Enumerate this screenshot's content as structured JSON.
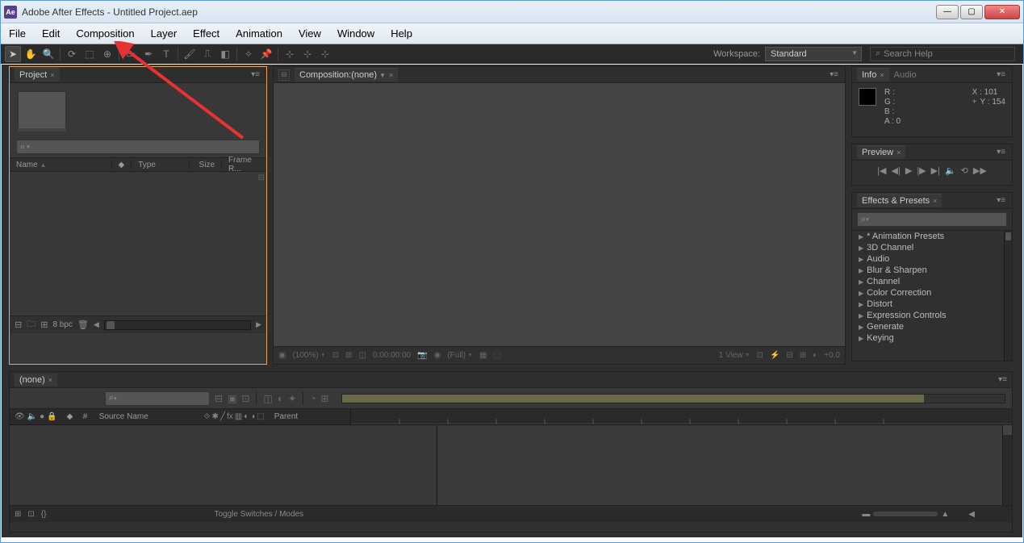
{
  "window": {
    "app_abbrev": "Ae",
    "title": "Adobe After Effects - Untitled Project.aep"
  },
  "menu": [
    "File",
    "Edit",
    "Composition",
    "Layer",
    "Effect",
    "Animation",
    "View",
    "Window",
    "Help"
  ],
  "toolbar": {
    "workspace_label": "Workspace:",
    "workspace_value": "Standard",
    "search_placeholder": "Search Help"
  },
  "project": {
    "tab": "Project",
    "search_placeholder": "",
    "cols": {
      "name": "Name",
      "type": "Type",
      "size": "Size",
      "frame": "Frame R..."
    },
    "bpc": "8 bpc"
  },
  "composition": {
    "tab_prefix": "Composition: ",
    "tab_name": "(none)",
    "zoom": "(100%)",
    "time": "0:00:00:00",
    "res": "(Full)",
    "views": "1 View",
    "exposure": "+0.0"
  },
  "info": {
    "tab": "Info",
    "tab2": "Audio",
    "r": "R :",
    "g": "G :",
    "b": "B :",
    "a_label": "A :",
    "a_val": "0",
    "x_label": "X :",
    "x_val": "101",
    "y_label": "Y :",
    "y_val": "154"
  },
  "preview": {
    "tab": "Preview"
  },
  "effects": {
    "tab": "Effects & Presets",
    "items": [
      "* Animation Presets",
      "3D Channel",
      "Audio",
      "Blur & Sharpen",
      "Channel",
      "Color Correction",
      "Distort",
      "Expression Controls",
      "Generate",
      "Keying"
    ]
  },
  "timeline": {
    "tab": "(none)",
    "col_num": "#",
    "col_source": "Source Name",
    "col_parent": "Parent",
    "toggle": "Toggle Switches / Modes"
  }
}
